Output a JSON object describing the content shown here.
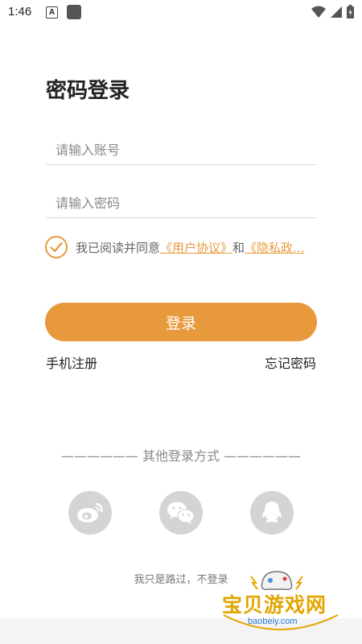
{
  "status_bar": {
    "time": "1:46",
    "letter_icon": "A"
  },
  "title": "密码登录",
  "account_field": {
    "placeholder": "请输入账号",
    "value": ""
  },
  "password_field": {
    "placeholder": "请输入密码",
    "value": ""
  },
  "agreement": {
    "checked": true,
    "prefix": "我已阅读并同意",
    "user_agreement": "《用户协议》",
    "and": "和",
    "privacy_policy": "《隐私政..."
  },
  "login_button": "登录",
  "register_link": "手机注册",
  "forgot_link": "忘记密码",
  "other_login_title": "—————— 其他登录方式 ——————",
  "social": [
    "weibo-icon",
    "wechat-icon",
    "qq-icon"
  ],
  "guest_link": "我只是路过，不登录",
  "watermark": {
    "text": "宝贝游戏网",
    "url": "baobeiy.com"
  },
  "colors": {
    "accent": "#e8993c",
    "icon_gray": "#d4d4d4"
  }
}
